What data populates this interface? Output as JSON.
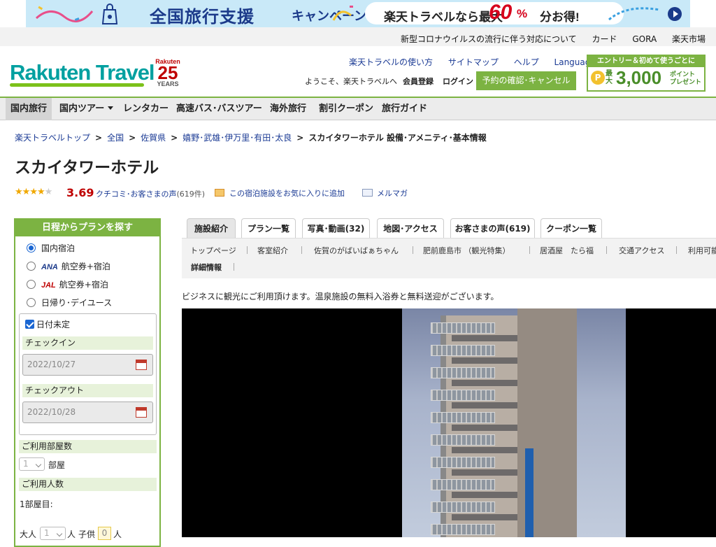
{
  "banner": {
    "title": "全国旅行支援",
    "campaign": "キャンペーン",
    "pill_text1": "楽天トラベルなら最大",
    "pill_pct": "60",
    "pill_unit": "%",
    "pill_text2": "分お得!"
  },
  "utility_links": [
    "新型コロナウイルスの流行に伴う対応について",
    "カード",
    "GORA",
    "楽天市場"
  ],
  "logo": {
    "text": "Rakuten Travel",
    "anniv_brand": "Rakuten",
    "anniv_num": "25",
    "anniv_word": "YEARS"
  },
  "header_links": [
    "楽天トラベルの使い方",
    "サイトマップ",
    "ヘルプ",
    "Languages"
  ],
  "welcome": "ようこそ、楽天トラベルへ",
  "register": "会員登録",
  "login": "ログイン",
  "reservation_button": "予約の確認･キャンセル",
  "promo": {
    "top": "エントリー＆初めて使うごとに",
    "coin": "P",
    "max": "最大",
    "amount": "3,000",
    "points_line1": "ポイント",
    "points_line2": "プレゼント"
  },
  "global_nav": [
    "国内旅行",
    "国内ツアー",
    "レンタカー",
    "高速バス･バスツアー",
    "海外旅行",
    "割引クーポン",
    "旅行ガイド"
  ],
  "breadcrumb": [
    "楽天トラベルトップ",
    "全国",
    "佐賀県",
    "嬉野･武雄･伊万里･有田･太良",
    "スカイタワーホテル 設備･アメニティ･基本情報"
  ],
  "breadcrumb_sep": ">",
  "hotel_name": "スカイタワーホテル",
  "rating": {
    "score": "3.69",
    "stars_filled": 3.7,
    "reviews_label": "クチコミ･お客さまの声",
    "reviews_count": "(619件)"
  },
  "favorite_label": "この宿泊施設をお気に入りに追加",
  "mailmag_label": "メルマガ",
  "search_panel": {
    "title": "日程からプランを探す",
    "options": [
      {
        "brand": "",
        "label": "国内宿泊",
        "selected": true
      },
      {
        "brand": "ANA",
        "label": "航空券+宿泊",
        "selected": false
      },
      {
        "brand": "JAL",
        "label": "航空券+宿泊",
        "selected": false
      },
      {
        "brand": "",
        "label": "日帰り･デイユース",
        "selected": false
      }
    ],
    "date_undecided": "日付未定",
    "checkin_label": "チェックイン",
    "checkin_value": "2022/10/27",
    "checkout_label": "チェックアウト",
    "checkout_value": "2022/10/28",
    "rooms_label": "ご利用部屋数",
    "rooms_value": "1",
    "rooms_unit": "部屋",
    "guests_label": "ご利用人数",
    "room1_label": "1部屋目:",
    "adult_label": "大人",
    "adult_value": "1",
    "adult_unit": "人",
    "child_label": "子供",
    "child_value": "0",
    "child_unit": "人"
  },
  "tabs": [
    "施設紹介",
    "プラン一覧",
    "写真･動画(32)",
    "地図･アクセス",
    "お客さまの声(619)",
    "クーポン一覧"
  ],
  "subnav": [
    "トップページ",
    "客室紹介",
    "佐賀のがばいばぁちゃん",
    "肥前鹿島市 （観光特集）",
    "居酒屋　たら福",
    "交通アクセス",
    "利用可能",
    "詳細情報"
  ],
  "description": "ビジネスに観光にご利用頂けます。温泉施設の無料入浴券と無料送迎がございます。",
  "colors": {
    "accent_green": "#7cb342",
    "link_blue": "#1a3a94",
    "price_red": "#bf0000",
    "brand_teal": "#00a0a0"
  }
}
